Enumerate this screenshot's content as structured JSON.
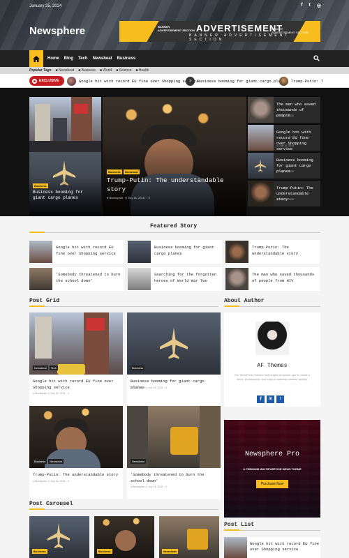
{
  "topbar": {
    "date": "January 25, 2024",
    "social": [
      "f",
      "t",
      "◎"
    ]
  },
  "site": {
    "title": "Newsphere"
  },
  "ad": {
    "small_left": [
      "BANNER",
      "ADVERTISEMENT SECTION"
    ],
    "big": "ADVERTISEMENT",
    "sub": "BANNER ADVERTISEMENT SECTION",
    "small_right": [
      "BANNER",
      "ADVERTISEMENT SECTION"
    ]
  },
  "nav": {
    "items": [
      "Home",
      "Blog",
      "Tech",
      "Newsbeat",
      "Business"
    ]
  },
  "tags": {
    "label": "Popular Tags",
    "items": [
      "Newsbeat",
      "Business",
      "World",
      "Science",
      "Health"
    ]
  },
  "ticker": {
    "label": "EXCLUSIVE",
    "items": [
      {
        "title": "Google hit with record EU fine over Shopping service"
      },
      {
        "num": "2",
        "title": "Business booming for giant cargo planes"
      },
      {
        "title": "Trump-Putin: T"
      }
    ]
  },
  "hero": {
    "left_bottom": {
      "badge": "Business",
      "title": "Business booming for giant cargo planes"
    },
    "center": {
      "badges": [
        "Business",
        "Newsbeat"
      ],
      "title": "Trump-Putin: The understandable story",
      "author": "Blockspare",
      "date": "July 16, 2018",
      "comments": "0"
    },
    "side": [
      {
        "title": "The man who saved thousands of people",
        "date": "July 16, 2018"
      },
      {
        "title": "Google hit with record EU fine over Shopping service",
        "date": "July 16, 2018"
      },
      {
        "title": "Business booming for giant cargo planes",
        "date": "July 16, 2018"
      },
      {
        "title": "Trump-Putin: The understandable story",
        "date": "July 16, 2018"
      }
    ]
  },
  "featured": {
    "title": "Featured Story",
    "items": [
      "Google hit with record EU fine over Shopping service",
      "Business booming for giant cargo planes",
      "Trump-Putin: The understandable story",
      "'Somebody threatened to burn the school down'",
      "Searching for the forgotten heroes of World War Two",
      "The man who saved thousands of people from HIV"
    ]
  },
  "post_grid": {
    "title": "Post Grid",
    "cards": [
      {
        "cats": [
          "Newsbeat",
          "Tech"
        ],
        "title": "Google hit with record EU fine over Shopping service",
        "author": "Blockspare",
        "date": "July 16, 2018",
        "comments": "0"
      },
      {
        "cats": [
          "Business"
        ],
        "title": "Business booming for giant cargo planes",
        "author": "Blockspare",
        "date": "July 16, 2018",
        "comments": "0"
      },
      {
        "cats": [
          "Business",
          "Newsbeat"
        ],
        "title": "Trump-Putin: The understandable story",
        "author": "Blockspare",
        "date": "July 16, 2018",
        "comments": "0"
      },
      {
        "cats": [
          "Newsbeat"
        ],
        "title": "'Somebody threatened to burn the school down'",
        "author": "Blockspare",
        "date": "July 16, 2018",
        "comments": "0"
      }
    ]
  },
  "about": {
    "title": "About Author",
    "name": "AF Themes",
    "desc": "Our WordPress themes and plugins empower you to create a sleek, professional, and easy-to-maintain website quickly."
  },
  "pro": {
    "title": "Newsphere Pro",
    "tagline": "A PREMIUM MULTIPURPOSE NEWS THEME",
    "cta": "Purchase Now"
  },
  "carousel": {
    "title": "Post Carousel",
    "badges": [
      "Business",
      "Business",
      "Newsbeat"
    ]
  },
  "post_list": {
    "title": "Post List",
    "first": "Google hit with record EU fine over Shopping service"
  },
  "colors": {
    "accent": "#f7bd1f",
    "red": "#c71c22",
    "dark": "#222222"
  }
}
